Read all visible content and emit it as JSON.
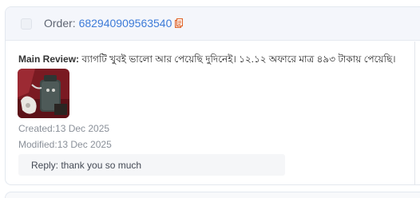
{
  "order": {
    "label": "Order:",
    "number": "682940909563540"
  },
  "review": {
    "label": "Main Review:",
    "text": "ব্যাগটি খুবই ভালো আর পেয়েছি দুদিনেই। ১২.১২ অফারে মাত্র ৪৯৩ টাকায় পেয়েছি।"
  },
  "meta": {
    "created": "Created:13 Dec 2025",
    "modified": "Modified:13 Dec 2025"
  },
  "reply": {
    "text": "Reply: thank you so much"
  },
  "icons": {
    "copy": "copy-icon",
    "thumbnail": "review-photo"
  },
  "colors": {
    "order_number": "#3d7bd8",
    "copy_icon": "#e0642a",
    "header_bg": "#f4f6fb"
  }
}
